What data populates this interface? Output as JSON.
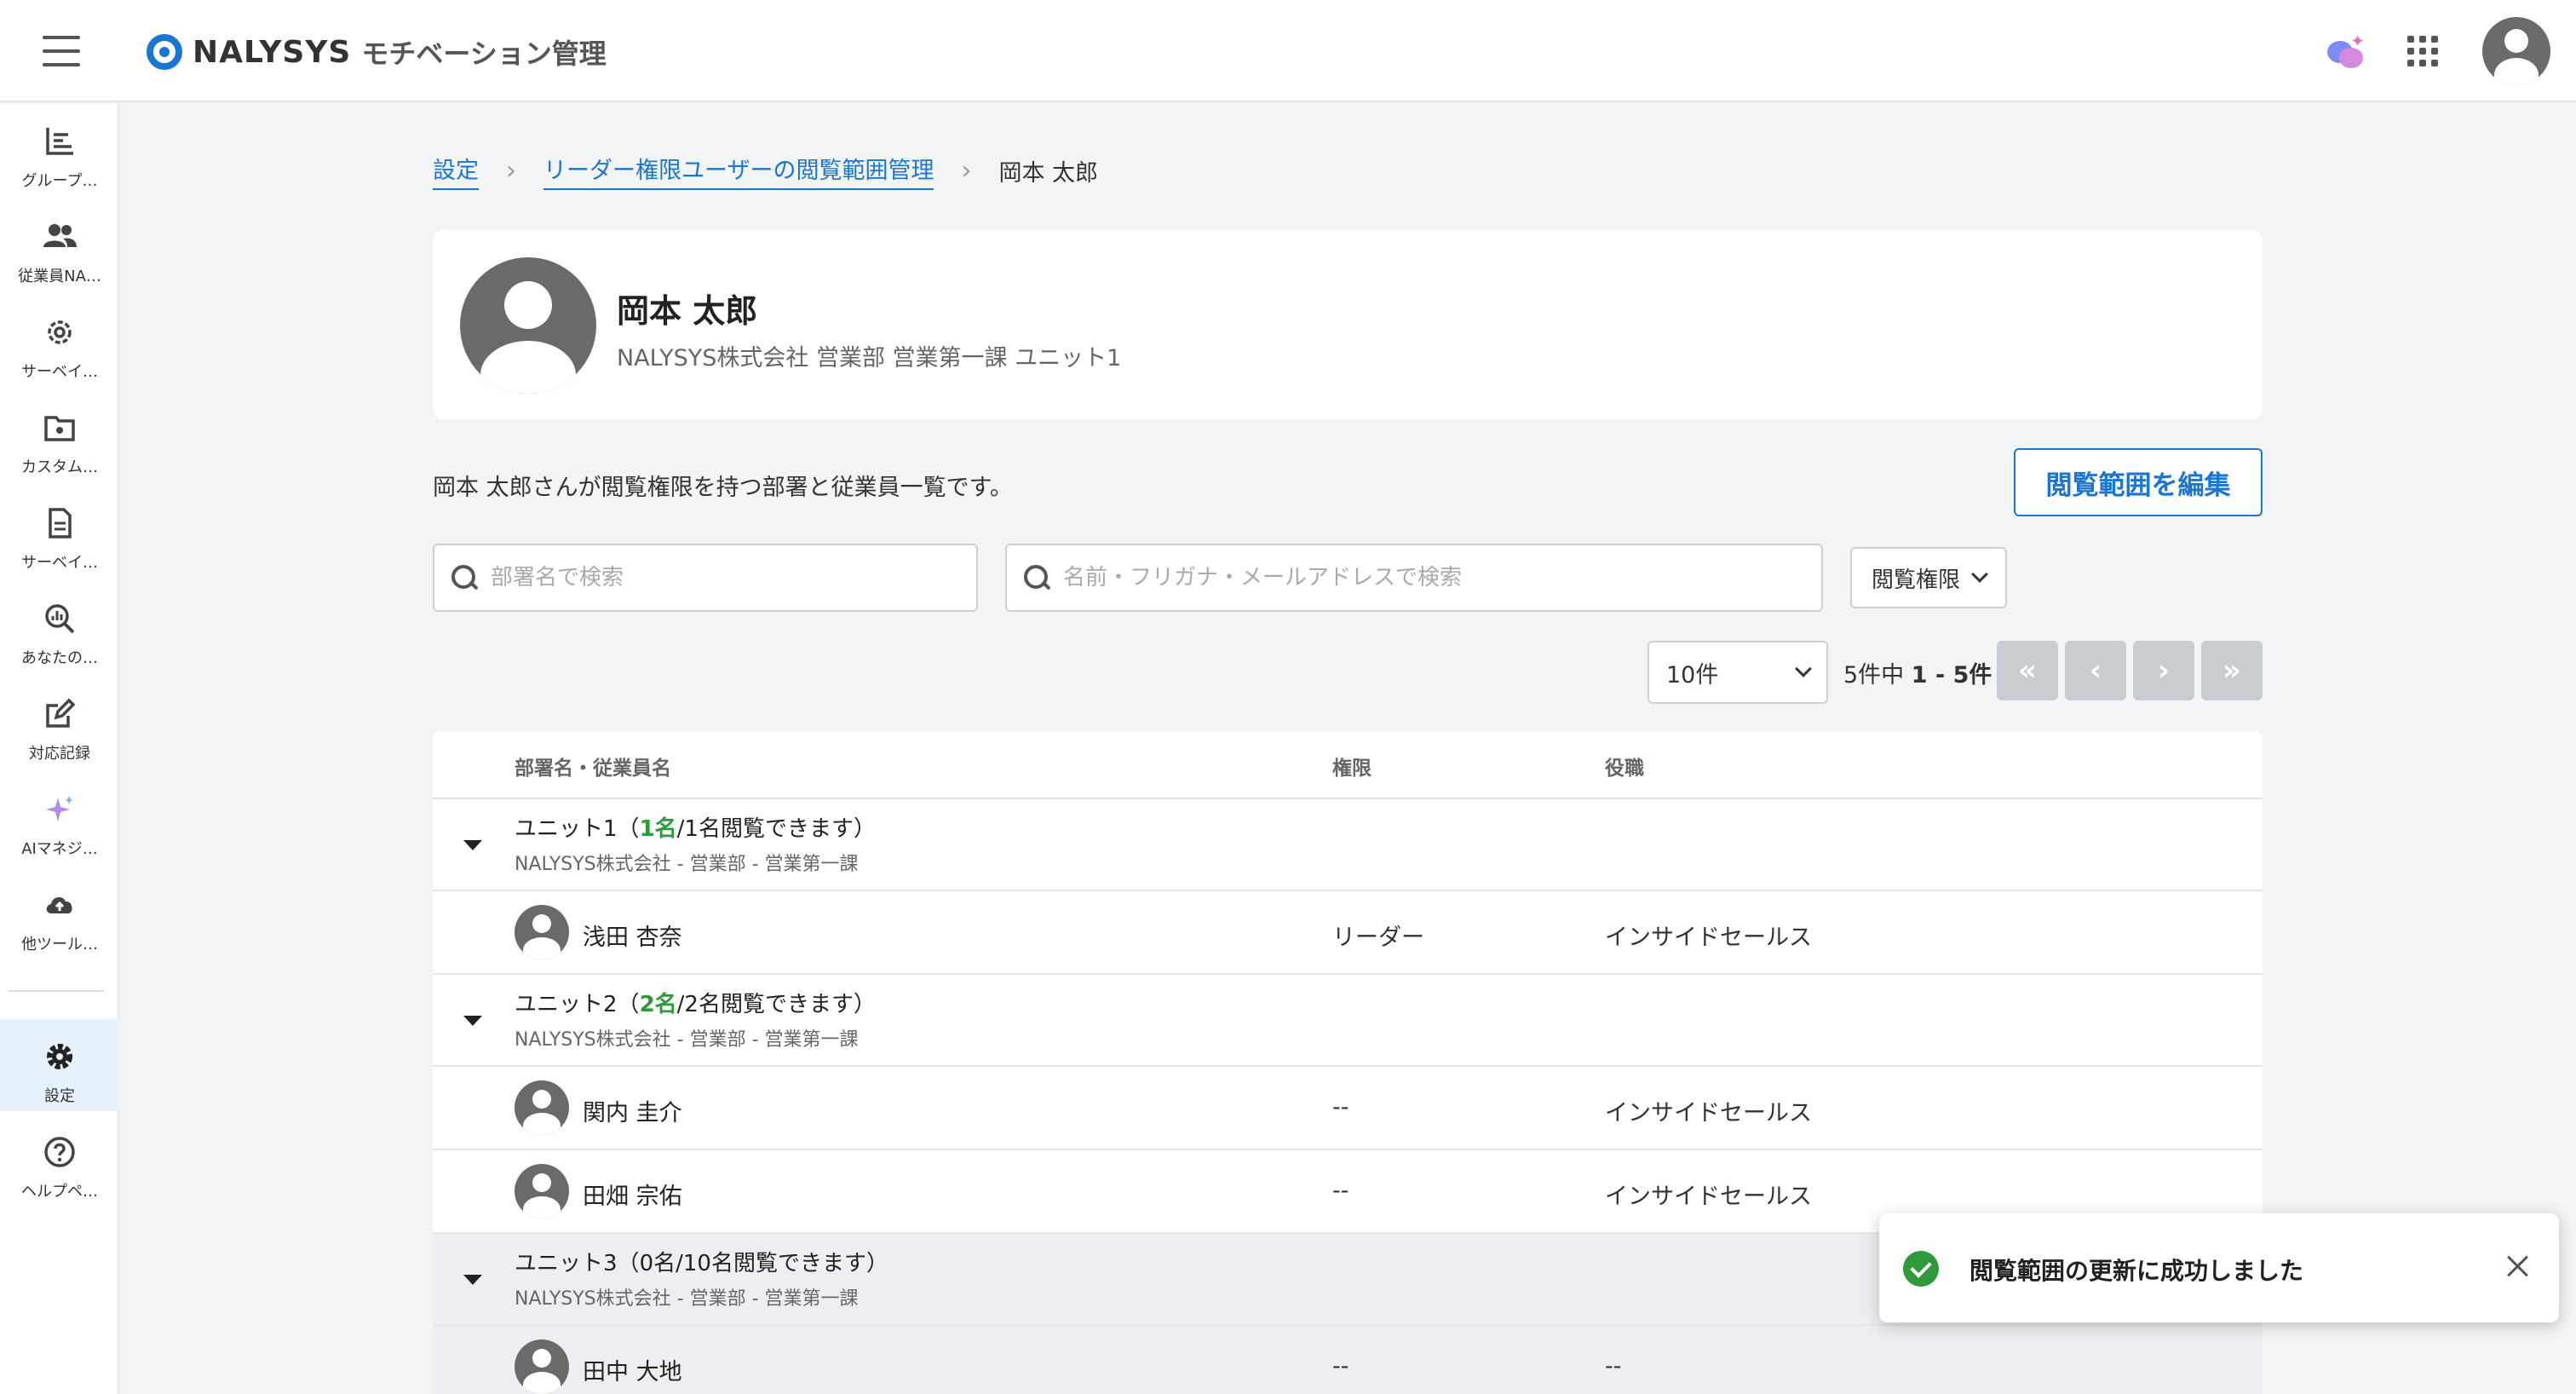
{
  "header": {
    "brand": "NALYSYS",
    "product": "モチベーション管理"
  },
  "sidebar": {
    "items": [
      {
        "label": "グループ…",
        "icon": "chart-icon"
      },
      {
        "label": "従業員NA…",
        "icon": "people-icon"
      },
      {
        "label": "サーベイ…",
        "icon": "gear-icon"
      },
      {
        "label": "カスタム…",
        "icon": "folder-gear-icon"
      },
      {
        "label": "サーベイ…",
        "icon": "document-icon"
      },
      {
        "label": "あなたの…",
        "icon": "search-chart-icon"
      },
      {
        "label": "対応記録",
        "icon": "edit-icon"
      },
      {
        "label": "AIマネジ…",
        "icon": "sparkle-icon"
      },
      {
        "label": "他ツール…",
        "icon": "cloud-upload-icon"
      },
      {
        "label": "設定",
        "icon": "settings-icon",
        "active": true
      },
      {
        "label": "ヘルプペ…",
        "icon": "help-icon"
      }
    ]
  },
  "breadcrumb": {
    "items": [
      "設定",
      "リーダー権限ユーザーの閲覧範囲管理"
    ],
    "current": "岡本 太郎"
  },
  "profile": {
    "name": "岡本 太郎",
    "org": "NALYSYS株式会社 営業部 営業第一課 ユニット1"
  },
  "description": "岡本 太郎さんが閲覧権限を持つ部署と従業員一覧です。",
  "edit_button": "閲覧範囲を編集",
  "search": {
    "dept_placeholder": "部署名で検索",
    "name_placeholder": "名前・フリガナ・メールアドレスで検索",
    "filter_label": "閲覧権限"
  },
  "pagination": {
    "per_page": "10件",
    "total": "5件中",
    "range": "1 - 5件",
    "first": "«",
    "prev": "‹",
    "next": "›",
    "last": "»"
  },
  "table": {
    "headers": [
      "部署名・従業員名",
      "権限",
      "役職"
    ],
    "units": [
      {
        "name": "ユニット1",
        "count": "1名",
        "suffix": "/1名閲覧できます）",
        "path": "NALYSYS株式会社 - 営業部 - 営業第一課"
      },
      {
        "name": "ユニット2",
        "count": "2名",
        "suffix": "/2名閲覧できます）",
        "path": "NALYSYS株式会社 - 営業部 - 営業第一課"
      },
      {
        "name": "ユニット3",
        "count": "0名",
        "suffix": "/10名閲覧できます）",
        "path": "NALYSYS株式会社 - 営業部 - 営業第一課"
      }
    ],
    "employees": [
      {
        "name": "浅田 杏奈",
        "role": "リーダー",
        "position": "インサイドセールス"
      },
      {
        "name": "関内 圭介",
        "role": "--",
        "position": "インサイドセールス"
      },
      {
        "name": "田畑 宗佑",
        "role": "--",
        "position": "インサイドセールス"
      },
      {
        "name": "田中 大地",
        "role": "--",
        "position": "--"
      }
    ]
  },
  "toast": {
    "message": "閲覧範囲の更新に成功しました"
  },
  "colors": {
    "accent": "#1976d2",
    "success": "#2e9a3a"
  }
}
